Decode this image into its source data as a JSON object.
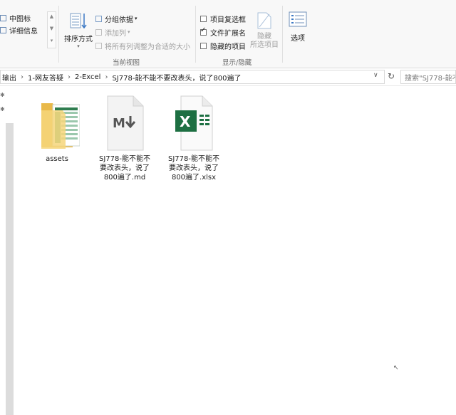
{
  "ribbon": {
    "layout": {
      "items": [
        "中图标",
        "详细信息"
      ]
    },
    "current_view": {
      "sort_label": "排序方式",
      "group_label": "分组依据",
      "add_column_label": "添加列",
      "fit_columns_label": "将所有列调整为合适的大小",
      "group_name": "当前视图"
    },
    "show_hide": {
      "item_checkboxes": {
        "label": "项目复选框",
        "checked": false
      },
      "file_extensions": {
        "label": "文件扩展名",
        "checked": true
      },
      "hidden_items": {
        "label": "隐藏的项目",
        "checked": false
      },
      "hide_selected_line1": "隐藏",
      "hide_selected_line2": "所选项目",
      "group_name": "显示/隐藏"
    },
    "options_label": "选项"
  },
  "address": {
    "crumbs": [
      "输出",
      "1-网友答疑",
      "2-Excel",
      "SJ778-能不能不要改表头，说了800遍了"
    ],
    "search_placeholder": "搜索\"SJ778-能不..."
  },
  "files": [
    {
      "name": "assets",
      "type": "folder-icon"
    },
    {
      "name": "SJ778-能不能不要改表头，说了800遍了.md",
      "type": "markdown-icon"
    },
    {
      "name": "SJ778-能不能不要改表头，说了800遍了.xlsx",
      "type": "excel-icon"
    }
  ],
  "colors": {
    "excel_green": "#1d6f42",
    "folder_yellow": "#f6d67b",
    "accent_blue": "#3b78c4"
  }
}
